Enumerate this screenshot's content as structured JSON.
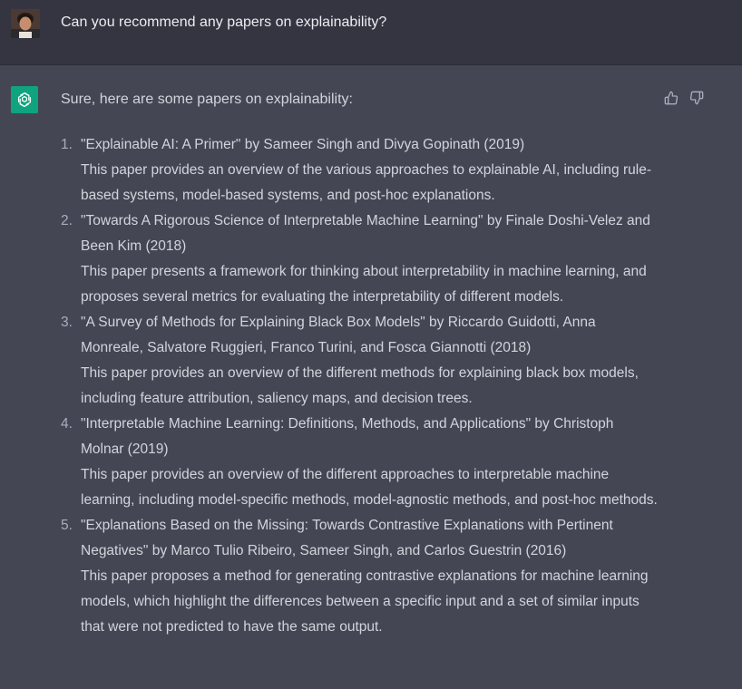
{
  "user": {
    "message": "Can you recommend any papers on explainability?"
  },
  "assistant": {
    "intro": "Sure, here are some papers on explainability:",
    "papers": [
      {
        "number": "1.",
        "title": "\"Explainable AI: A Primer\" by Sameer Singh and Divya Gopinath (2019)",
        "description": "This paper provides an overview of the various approaches to explainable AI, including rule-based systems, model-based systems, and post-hoc explanations."
      },
      {
        "number": "2.",
        "title": "\"Towards A Rigorous Science of Interpretable Machine Learning\" by Finale Doshi-Velez and Been Kim (2018)",
        "description": "This paper presents a framework for thinking about interpretability in machine learning, and proposes several metrics for evaluating the interpretability of different models."
      },
      {
        "number": "3.",
        "title": "\"A Survey of Methods for Explaining Black Box Models\" by Riccardo Guidotti, Anna Monreale, Salvatore Ruggieri, Franco Turini, and Fosca Giannotti (2018)",
        "description": "This paper provides an overview of the different methods for explaining black box models, including feature attribution, saliency maps, and decision trees."
      },
      {
        "number": "4.",
        "title": "\"Interpretable Machine Learning: Definitions, Methods, and Applications\" by Christoph Molnar (2019)",
        "description": "This paper provides an overview of the different approaches to interpretable machine learning, including model-specific methods, model-agnostic methods, and post-hoc methods."
      },
      {
        "number": "5.",
        "title": "\"Explanations Based on the Missing: Towards Contrastive Explanations with Pertinent Negatives\" by Marco Tulio Ribeiro, Sameer Singh, and Carlos Guestrin (2016)",
        "description": "This paper proposes a method for generating contrastive explanations for machine learning models, which highlight the differences between a specific input and a set of similar inputs that were not predicted to have the same output."
      }
    ],
    "feedback": {
      "thumbs_up_icon": "thumbs-up-icon",
      "thumbs_down_icon": "thumbs-down-icon"
    }
  },
  "colors": {
    "user_bg": "#343541",
    "assistant_bg": "#444654",
    "assistant_avatar": "#10a37f",
    "text": "#d1d5db"
  }
}
